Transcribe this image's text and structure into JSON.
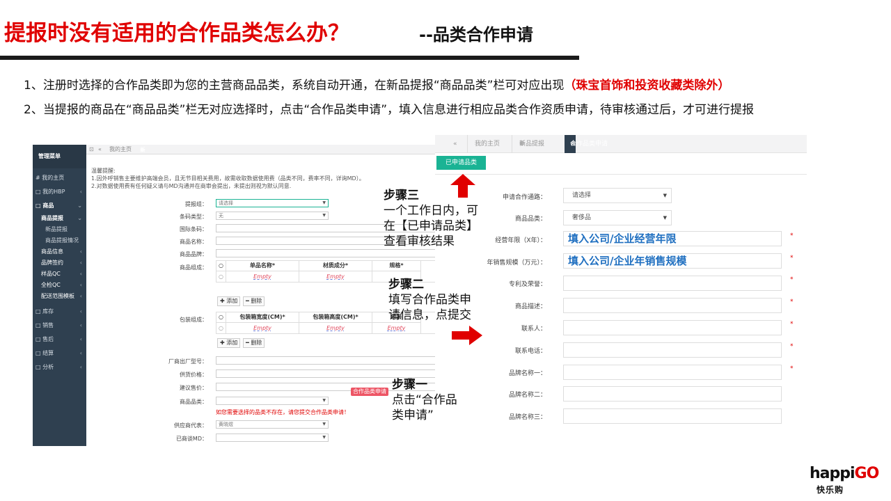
{
  "title": {
    "main": "提报时没有适用的合作品类怎么办？",
    "sub": "--品类合作申请"
  },
  "description": {
    "line1_text": "1、注册时选择的合作品类即为您的主营商品品类，系统自动开通，在新品提报“商品品类”栏可对应出现",
    "line1_highlight": "（珠宝首饰和投资收藏类除外）",
    "line2_text": "2、当提报的商品在“商品品类”栏无对应选择时，点击“合作品类申请”，填入信息进行相应品类合作资质申请，待审核通过后，才可进行提报"
  },
  "steps": {
    "step1": {
      "head": "步骤一",
      "body_line1": "点击“合作品",
      "body_line2": "类申请”"
    },
    "step2": {
      "head": "步骤二",
      "body_line1": "填写合作品类申",
      "body_line2": "请信息，点提交"
    },
    "step3": {
      "head": "步骤三",
      "body_line1": "一个工作日内，可",
      "body_line2": "在【已申请品类】",
      "body_line3": "查看审核结果"
    }
  },
  "screen1": {
    "sidebar": {
      "header": "管理菜单",
      "items": [
        {
          "label": "# 我的主页"
        },
        {
          "label": "□ 我的HBP"
        },
        {
          "label": "□ 商品"
        },
        {
          "label": "商品提报"
        },
        {
          "label": "新品提报"
        },
        {
          "label": "商品提报情况"
        },
        {
          "label": "商品信息"
        },
        {
          "label": "品牌签约"
        },
        {
          "label": "样品QC"
        },
        {
          "label": "全检QC"
        },
        {
          "label": "配送范围模板"
        },
        {
          "label": "□ 库存"
        },
        {
          "label": "□ 销售"
        },
        {
          "label": "□ 售后"
        },
        {
          "label": "□ 结算"
        },
        {
          "label": "□ 分析"
        }
      ]
    },
    "tabs": {
      "home": "我的主页",
      "active": "新品提报"
    },
    "notice_title": "温馨提醒:",
    "notice_line1": "1.因外呼销售主要维护高端会员，且无节目相关费用，故需收取数据使用费（品类不同，费率不同，详询MD）。",
    "notice_line2": "2.对数据使用费有任何疑义请与MD沟通并在商审会提出，未提出则视为默认同意.",
    "form": {
      "report_group": {
        "label": "提报组：",
        "value": "请选择"
      },
      "barcode_type": {
        "label": "条码类型：",
        "value": "无"
      },
      "intl_barcode": {
        "label": "国际条码："
      },
      "product_name": {
        "label": "商品名称："
      },
      "product_brand": {
        "label": "商品品牌："
      },
      "product_compose": {
        "label": "商品组成："
      },
      "compose_headers": [
        "单品名称*",
        "材质成分*",
        "规格*"
      ],
      "compose_values": [
        "Empty",
        "Empty",
        ""
      ],
      "add_btn": "添加",
      "del_btn": "删除",
      "pack_compose": {
        "label": "包装组成："
      },
      "pack_headers": [
        "包装箱宽度(CM)*",
        "包装箱高度(CM)*",
        "包装"
      ],
      "pack_values": [
        "Empty",
        "Empty",
        "Empty"
      ],
      "factory_model": {
        "label": "厂商出厂型号："
      },
      "supply_price": {
        "label": "供货价格："
      },
      "suggest_price": {
        "label": "建议售价："
      },
      "category": {
        "label": "商品品类："
      },
      "apply_button": "合作品类申请",
      "warning": "如您需要选择的品类不存在，请您提交合作品类申请！",
      "supplier_rep": {
        "label": "供应商代表：",
        "value": "黄晓煜"
      },
      "md": {
        "label": "已商谈MD："
      }
    }
  },
  "screen2": {
    "tabs": {
      "home": "我的主页",
      "newreport": "新品提报",
      "active": "合作品类申请"
    },
    "applied_button": "已申请品类",
    "form": [
      {
        "label": "申请合作通路：",
        "value": "请选择",
        "type": "select",
        "required": false
      },
      {
        "label": "商品品类：",
        "value": "奢侈品",
        "type": "select",
        "required": false
      },
      {
        "label": "经营年限（X年）：",
        "value": "填入公司/企业经营年限",
        "type": "big",
        "required": true
      },
      {
        "label": "年销售规模（万元）：",
        "value": "填入公司/企业年销售规模",
        "type": "big",
        "required": true
      },
      {
        "label": "专利及荣誉：",
        "value": "",
        "type": "input",
        "required": true
      },
      {
        "label": "商品描述：",
        "value": "",
        "type": "input",
        "required": true
      },
      {
        "label": "联系人：",
        "value": "",
        "type": "input",
        "required": true
      },
      {
        "label": "联系电话：",
        "value": "",
        "type": "input",
        "required": true
      },
      {
        "label": "品牌名称一：",
        "value": "",
        "type": "input",
        "required": true
      },
      {
        "label": "品牌名称二：",
        "value": "",
        "type": "input",
        "required": false
      },
      {
        "label": "品牌名称三：",
        "value": "",
        "type": "input",
        "required": false
      }
    ]
  },
  "logo": {
    "en_a": "happi",
    "en_b": "GO",
    "zh": "快乐购"
  },
  "colors": {
    "accent_red": "#e00000",
    "sidebar": "#2f4050",
    "green": "#1ab394",
    "blue_text": "#1f6fc0"
  }
}
